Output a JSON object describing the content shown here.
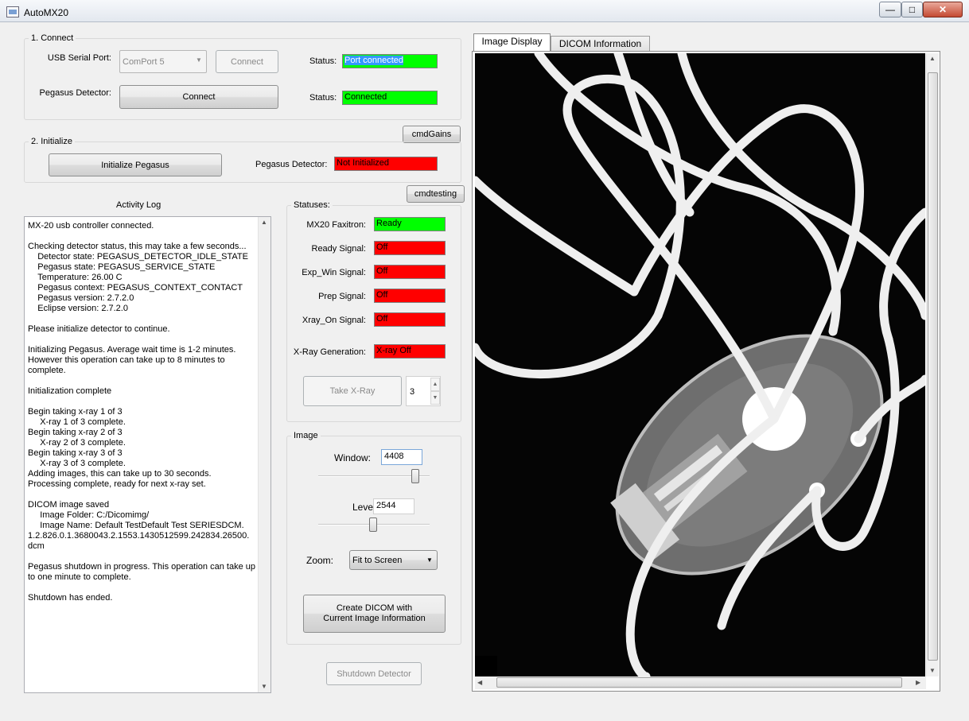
{
  "window": {
    "title": "AutoMX20",
    "minimize": "—",
    "maximize": "□",
    "close": "✕",
    "icon": "app-window-icon"
  },
  "connect": {
    "group_label": "1. Connect",
    "usb_label": "USB Serial Port:",
    "usb_selected": "ComPort 5",
    "usb_connect": "Connect",
    "usb_status_label": "Status:",
    "usb_status": "Port connected",
    "pegasus_label": "Pegasus Detector:",
    "pegasus_connect": "Connect",
    "pegasus_status_label": "Status:",
    "pegasus_status": "Connected"
  },
  "cmd_gains": "cmdGains",
  "initialize": {
    "group_label": "2. Initialize",
    "button": "Initialize Pegasus",
    "detector_label": "Pegasus Detector:",
    "detector_status": "Not Initialized"
  },
  "cmd_testing": "cmdtesting",
  "log": {
    "title": "Activity Log",
    "text": "MX-20 usb controller connected.\n\nChecking detector status, this may take a few seconds...\n    Detector state: PEGASUS_DETECTOR_IDLE_STATE\n    Pegasus state: PEGASUS_SERVICE_STATE\n    Temperature: 26.00 C\n    Pegasus context: PEGASUS_CONTEXT_CONTACT\n    Pegasus version: 2.7.2.0\n    Eclipse version: 2.7.2.0\n\nPlease initialize detector to continue.\n\nInitializing Pegasus. Average wait time is 1-2 minutes.\nHowever this operation can take up to 8 minutes to\ncomplete.\n\nInitialization complete\n\nBegin taking x-ray 1 of 3\n     X-ray 1 of 3 complete.\nBegin taking x-ray 2 of 3\n     X-ray 2 of 3 complete.\nBegin taking x-ray 3 of 3\n     X-ray 3 of 3 complete.\nAdding images, this can take up to 30 seconds.\nProcessing complete, ready for next x-ray set.\n\nDICOM image saved\n     Image Folder: C:/Dicomimg/\n     Image Name: Default TestDefault Test SERIESDCM.\n1.2.826.0.1.3680043.2.1553.1430512599.242834.26500.\ndcm\n\nPegasus shutdown in progress. This operation can take up\nto one minute to complete.\n\nShutdown has ended."
  },
  "statuses": {
    "group_label": "Statuses:",
    "faxitron_label": "MX20 Faxitron:",
    "faxitron_value": "Ready",
    "ready_label": "Ready Signal:",
    "ready_value": "Off",
    "expwin_label": "Exp_Win Signal:",
    "expwin_value": "Off",
    "prep_label": "Prep Signal:",
    "prep_value": "Off",
    "xrayon_label": "Xray_On Signal:",
    "xrayon_value": "Off",
    "generation_label": "X-Ray Generation:",
    "generation_value": "X-ray Off",
    "take_xray": "Take X-Ray",
    "count": "3"
  },
  "image": {
    "group_label": "Image",
    "window_label": "Window:",
    "window_value": "4408",
    "window_slider_fraction": 0.9,
    "level_label": "Level:",
    "level_value": "2544",
    "level_slider_fraction": 0.49,
    "zoom_label": "Zoom:",
    "zoom_value": "Fit to Screen",
    "create_dicom_line1": "Create DICOM with",
    "create_dicom_line2": "Current Image Information"
  },
  "shutdown": "Shutdown Detector",
  "tabs": {
    "image_display": "Image Display",
    "dicom_info": "DICOM Information"
  },
  "colors": {
    "ok": "#00ff00",
    "error": "#ff0000"
  }
}
